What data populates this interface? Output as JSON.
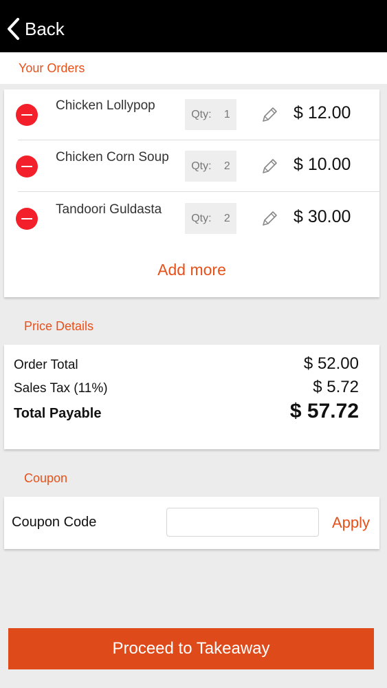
{
  "header": {
    "back_label": "Back"
  },
  "sections": {
    "orders_title": "Your Orders",
    "price_title": "Price Details",
    "coupon_title": "Coupon"
  },
  "orders": [
    {
      "name": "Chicken Lollypop",
      "qty_label": "Qty:",
      "qty": "1",
      "price": "$ 12.00"
    },
    {
      "name": "Chicken Corn Soup",
      "qty_label": "Qty:",
      "qty": "2",
      "price": "$ 10.00"
    },
    {
      "name": "Tandoori Guldasta",
      "qty_label": "Qty:",
      "qty": "2",
      "price": "$ 30.00"
    }
  ],
  "add_more_label": "Add more",
  "price_details": {
    "order_total_label": "Order Total",
    "order_total": "$ 52.00",
    "tax_label": "Sales Tax (11%)",
    "tax": "$ 5.72",
    "payable_label": "Total Payable",
    "payable": "$ 57.72"
  },
  "coupon": {
    "label": "Coupon Code",
    "value": "",
    "placeholder": "",
    "apply_label": "Apply"
  },
  "proceed_label": "Proceed to Takeaway",
  "colors": {
    "accent": "#e8501a",
    "remove": "#f3202b",
    "header_bg": "#000000",
    "page_bg": "#ececec"
  },
  "icons": {
    "back": "chevron-left-icon",
    "remove": "minus-circle-icon",
    "edit": "pencil-icon"
  }
}
